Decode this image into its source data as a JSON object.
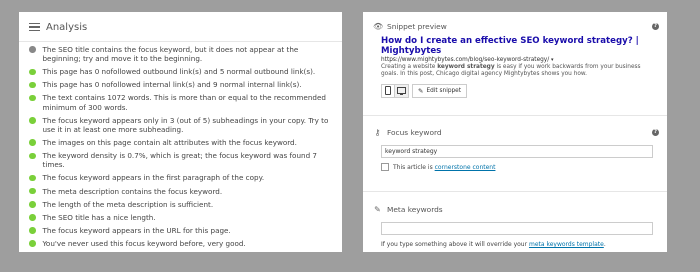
{
  "analysis": {
    "title": "Analysis",
    "icon": "list-icon",
    "items": [
      {
        "status": "grey",
        "text": "The SEO title contains the focus keyword, but it does not appear at the beginning; try and move it to the beginning."
      },
      {
        "status": "green",
        "text": "This page has 0 nofollowed outbound link(s) and 5 normal outbound link(s)."
      },
      {
        "status": "green",
        "text": "This page has 0 nofollowed internal link(s) and 9 normal internal link(s)."
      },
      {
        "status": "green",
        "text": "The text contains 1072 words. This is more than or equal to the recommended minimum of 300 words."
      },
      {
        "status": "green",
        "text": "The focus keyword appears only in 3 (out of 5) subheadings in your copy. Try to use it in at least one more subheading."
      },
      {
        "status": "green",
        "text": "The images on this page contain alt attributes with the focus keyword."
      },
      {
        "status": "green",
        "text": "The keyword density is 0.7%, which is great; the focus keyword was found 7 times."
      },
      {
        "status": "green",
        "text": "The focus keyword appears in the first paragraph of the copy."
      },
      {
        "status": "green",
        "text": "The meta description contains the focus keyword."
      },
      {
        "status": "green",
        "text": "The length of the meta description is sufficient."
      },
      {
        "status": "green",
        "text": "The SEO title has a nice length."
      },
      {
        "status": "green",
        "text": "The focus keyword appears in the URL for this page."
      },
      {
        "status": "green",
        "text": "You've never used this focus keyword before, very good."
      }
    ]
  },
  "colors": {
    "green": "#7ad03a",
    "grey": "#888888",
    "link": "#1a0dab",
    "wp_link": "#0073aa"
  },
  "snippet": {
    "header": "Snippet preview",
    "help": "?",
    "title": "How do I create an effective SEO keyword strategy? | Mightybytes",
    "url": "https://www.mightybytes.com/blog/seo-keyword-strategy/",
    "url_caret": "▾",
    "desc_1": "Creating a website ",
    "desc_bold": "keyword strategy",
    "desc_2": " is easy if you work backwards from your business goals. In this post, Chicago digital agency Mightybytes shows you how.",
    "edit_label": "Edit snippet"
  },
  "focus": {
    "header": "Focus keyword",
    "help": "?",
    "value": "keyword strategy",
    "cornerstone_prefix": "This article is ",
    "cornerstone_link": "cornerstone content"
  },
  "meta": {
    "header": "Meta keywords",
    "value": "",
    "note_prefix": "If you type something above it will override your ",
    "note_link": "meta keywords template",
    "note_suffix": "."
  }
}
